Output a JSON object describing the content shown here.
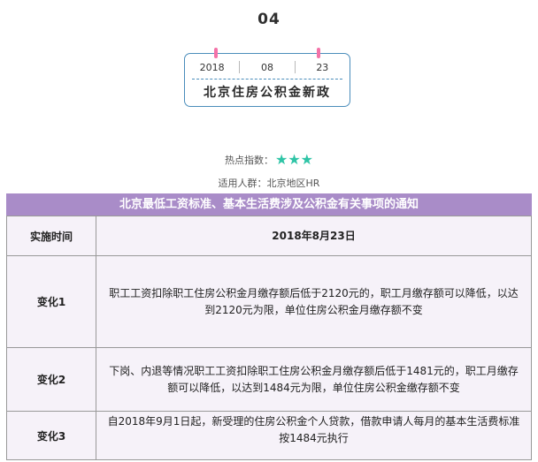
{
  "issue_number": "04",
  "calendar": {
    "year": "2018",
    "month": "08",
    "day": "23",
    "title": "北京住房公积金新政"
  },
  "meta": {
    "hot_label": "热点指数：",
    "stars": "★★★",
    "audience": "适用人群：北京地区HR"
  },
  "notice": {
    "title": "北京最低工资标准、基本生活费涉及公积金有关事项的通知",
    "rows": [
      {
        "label": "实施时间",
        "content": "2018年8月23日"
      },
      {
        "label": "变化1",
        "content": "职工工资扣除职工住房公积金月缴存额后低于2120元的，职工月缴存额可以降低，以达到2120元为限，单位住房公积金月缴存额不变"
      },
      {
        "label": "变化2",
        "content": "下岗、内退等情况职工工资扣除职工住房公积金月缴存额后低于1481元的，职工月缴存额可以降低，以达到1484元为限，单位住房公积金缴存额不变"
      },
      {
        "label": "变化3",
        "content": "自2018年9月1日起，新受理的住房公积金个人贷款，借款申请人每月的基本生活费标准按1484元执行"
      }
    ]
  },
  "colors": {
    "accent_border": "#4a8dbb",
    "pin": "#f472a8",
    "star": "#2ec4a6",
    "title_bar": "#a98cc8",
    "cell_bg": "#f6f2f9"
  }
}
